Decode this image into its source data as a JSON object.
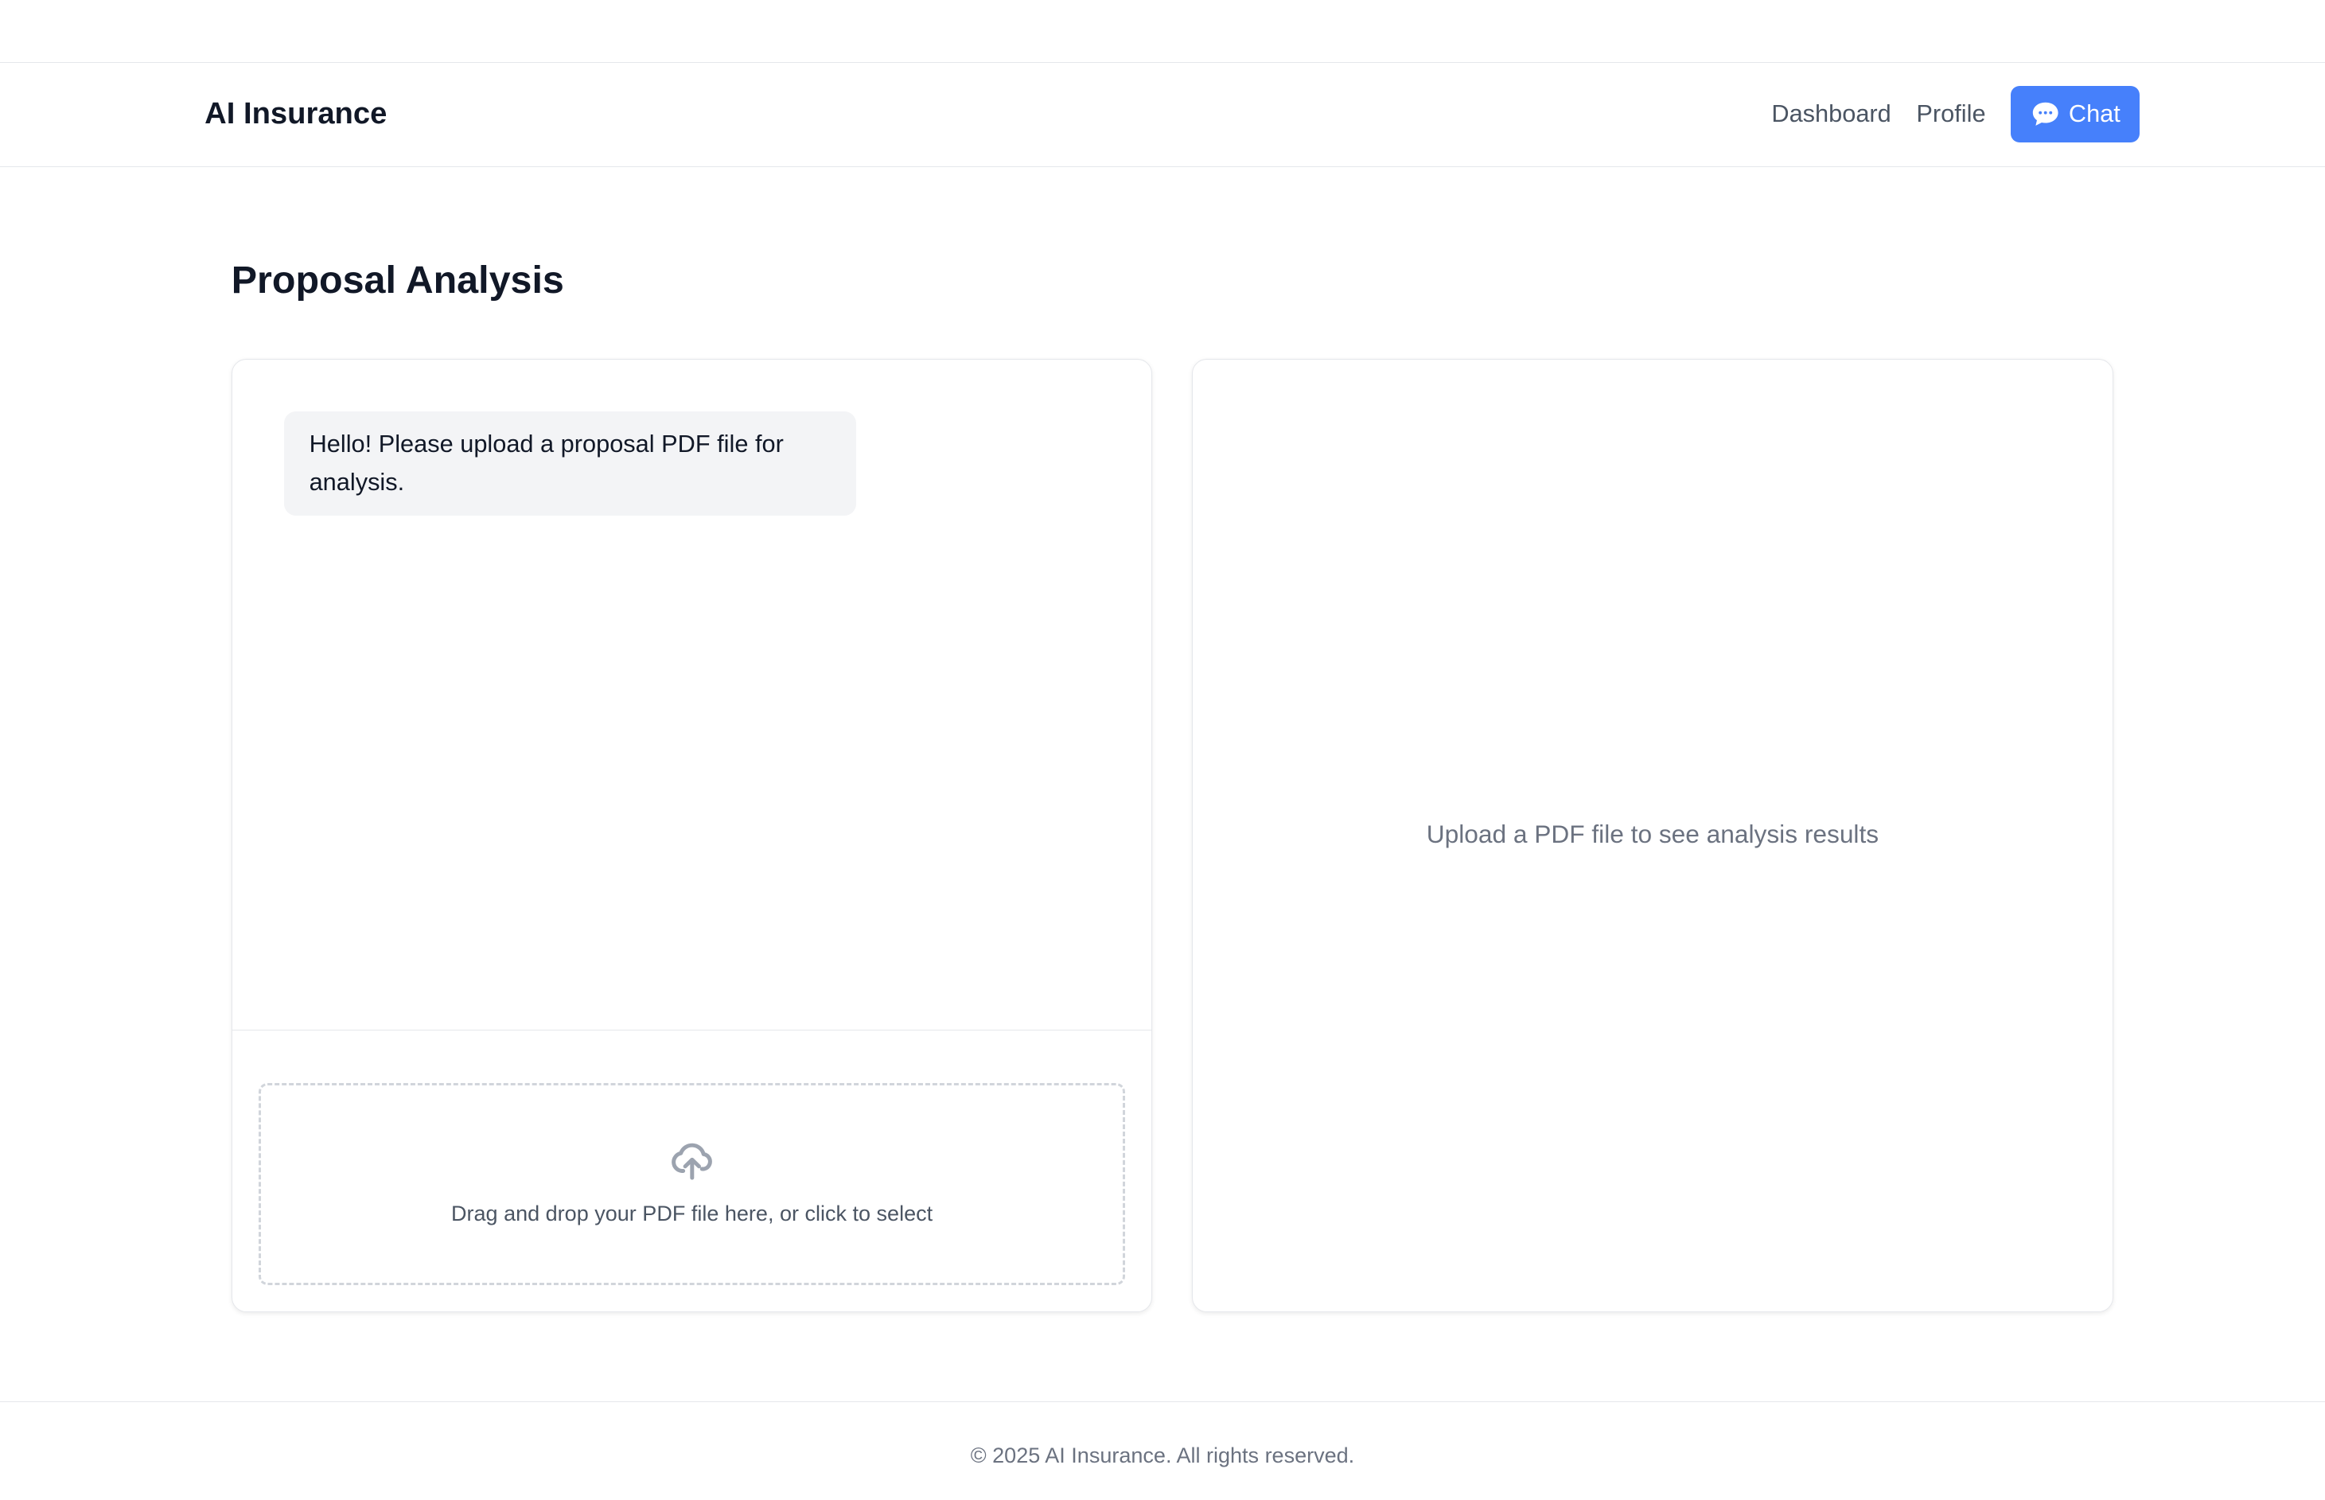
{
  "header": {
    "logo": "AI Insurance",
    "nav": {
      "dashboard": "Dashboard",
      "profile": "Profile",
      "chat": "Chat"
    }
  },
  "page": {
    "title": "Proposal Analysis",
    "chat": {
      "messages": [
        {
          "role": "assistant",
          "text": "Hello! Please upload a proposal PDF file for analysis."
        }
      ],
      "upload": {
        "label": "Drag and drop your PDF file here, or click to select",
        "icon": "cloud-upload-icon"
      }
    },
    "results": {
      "placeholder": "Upload a PDF file to see analysis results"
    }
  },
  "footer": {
    "copyright": "© 2025 AI Insurance. All rights reserved."
  },
  "colors": {
    "accent": "#4680fb",
    "bubble": "#f3f4f6",
    "border": "#e5e7eb"
  }
}
